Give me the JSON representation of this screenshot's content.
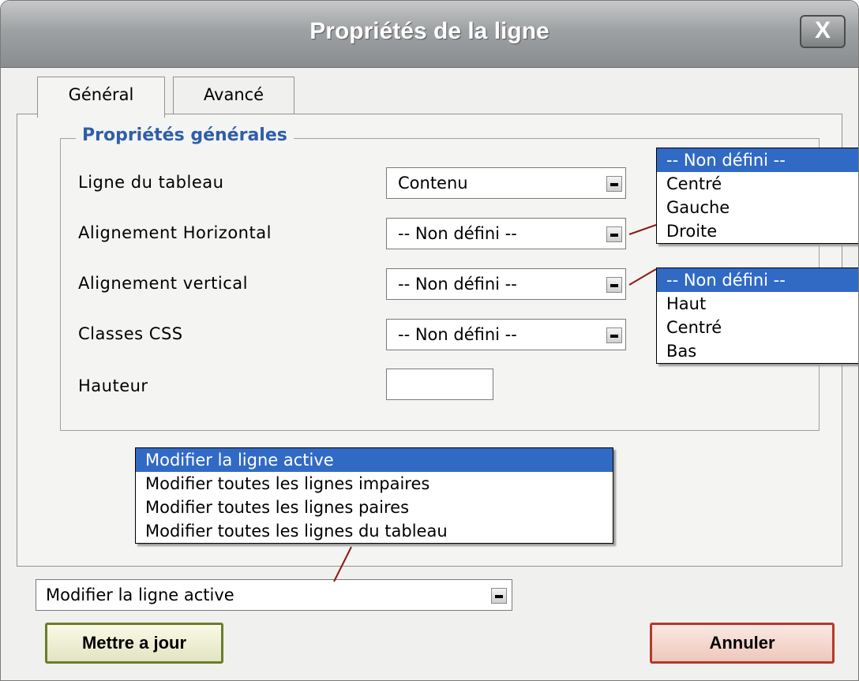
{
  "window": {
    "title": "Propriétés de la ligne",
    "close_label": "X"
  },
  "tabs": [
    {
      "label": "Général",
      "active": true
    },
    {
      "label": "Avancé",
      "active": false
    }
  ],
  "general": {
    "legend": "Propriétés générales",
    "fields": {
      "row_type": {
        "label": "Ligne du tableau",
        "value": "Contenu"
      },
      "halign": {
        "label": "Alignement Horizontal",
        "value": "-- Non défini --"
      },
      "valign": {
        "label": "Alignement vertical",
        "value": "-- Non défini --"
      },
      "css_classes": {
        "label": "Classes CSS",
        "value": "-- Non défini --"
      },
      "height": {
        "label": "Hauteur",
        "value": ""
      }
    }
  },
  "halign_options": [
    "-- Non défini --",
    "Centré",
    "Gauche",
    "Droite"
  ],
  "valign_options": [
    "-- Non défini --",
    "Haut",
    "Centré",
    "Bas"
  ],
  "action": {
    "value": "Modifier la ligne active",
    "options": [
      "Modifier la ligne active",
      "Modifier toutes les lignes impaires",
      "Modifier toutes les lignes paires",
      "Modifier toutes les lignes du tableau"
    ]
  },
  "buttons": {
    "update": "Mettre a jour",
    "cancel": "Annuler"
  },
  "colors": {
    "selection": "#316ac5",
    "legend": "#2f5ea8",
    "connector": "#8b1a1a",
    "update_border": "#6a7d2c",
    "cancel_border": "#b43a2a"
  }
}
